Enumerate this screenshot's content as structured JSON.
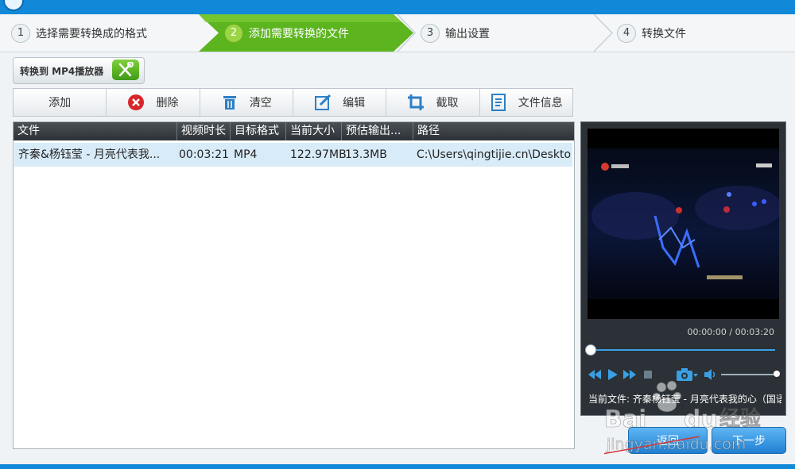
{
  "steps": [
    {
      "num": "1",
      "label": "选择需要转换成的格式"
    },
    {
      "num": "2",
      "label": "添加需要转换的文件"
    },
    {
      "num": "3",
      "label": "输出设置"
    },
    {
      "num": "4",
      "label": "转换文件"
    }
  ],
  "mp4_button": {
    "label": "转换到 MP4播放器"
  },
  "toolbar": [
    {
      "label": "添加",
      "icon": "add-icon"
    },
    {
      "label": "删除",
      "icon": "delete-icon"
    },
    {
      "label": "清空",
      "icon": "trash-icon"
    },
    {
      "label": "编辑",
      "icon": "edit-icon"
    },
    {
      "label": "截取",
      "icon": "crop-icon"
    },
    {
      "label": "文件信息",
      "icon": "file-info-icon"
    }
  ],
  "table": {
    "columns": [
      "文件",
      "视频时长",
      "目标格式",
      "当前大小",
      "预估输出...",
      "路径"
    ],
    "rows": [
      {
        "file": "齐秦&杨钰莹 - 月亮代表我...",
        "duration": "00:03:21",
        "format": "MP4",
        "size": "122.97MB",
        "output": "13.3MB",
        "path": "C:\\Users\\qingtijie.cn\\Deskto..."
      }
    ]
  },
  "player": {
    "time": "00:00:00 / 00:03:20",
    "current_file": "当前文件: 齐秦杨钰莹 - 月亮代表我的心（国语"
  },
  "nav": {
    "back": "返回",
    "next": "下一步"
  },
  "watermark": {
    "text": "Bai du 经验",
    "url": "jingyan.baidu.com"
  },
  "colors": {
    "accent": "#1188d8",
    "active_step": "#5cb51f",
    "header": "#2d3236",
    "selected_row": "#d8ebf8"
  }
}
